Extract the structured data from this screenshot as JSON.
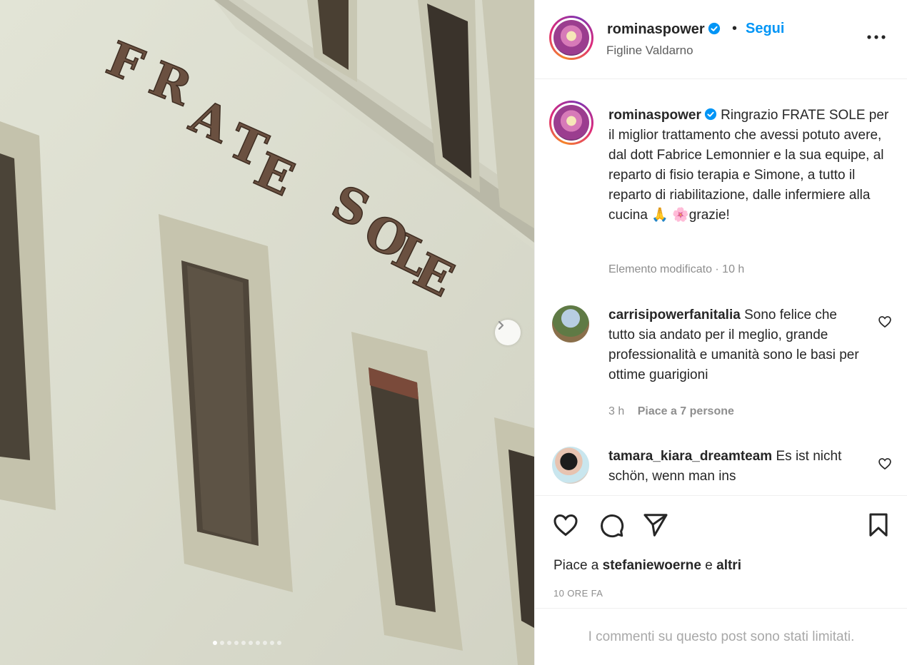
{
  "post": {
    "username": "rominaspower",
    "follow_label": "Segui",
    "separator": "•",
    "location": "Figline Valdarno",
    "sign_text": "FRATE SOLE",
    "carousel": {
      "count": 10,
      "active_index": 0
    }
  },
  "caption": {
    "username": "rominaspower",
    "text": "Ringrazio FRATE SOLE per il miglior trattamento che avessi potuto avere, dal dott Fabrice Lemonnier e la sua equipe, al reparto di fisio terapia e Simone, a tutto il reparto di riabilitazione, dalle infermiere alla cucina 🙏 🌸grazie!",
    "meta": "Elemento modificato · 10 h"
  },
  "comments": [
    {
      "username": "carrisipowerfanitalia",
      "text": "Sono felice che tutto sia andato per il meglio, grande professionalità e umanità sono le basi per ottime guarigioni",
      "time": "3 h",
      "likes": "Piace a 7 persone"
    },
    {
      "username": "tamara_kiara_dreamteam",
      "text": "Es ist nicht schön, wenn man ins"
    }
  ],
  "likes_line": {
    "prefix": "Piace a",
    "user": "stefaniewoerne",
    "middle": "e",
    "suffix": "altri"
  },
  "time_ago": "10 ORE FA",
  "comments_limited": "I commenti su questo post sono stati limitati.",
  "colors": {
    "accent": "#0095f6",
    "muted": "#8e8e8e",
    "verified": "#0095f6"
  }
}
